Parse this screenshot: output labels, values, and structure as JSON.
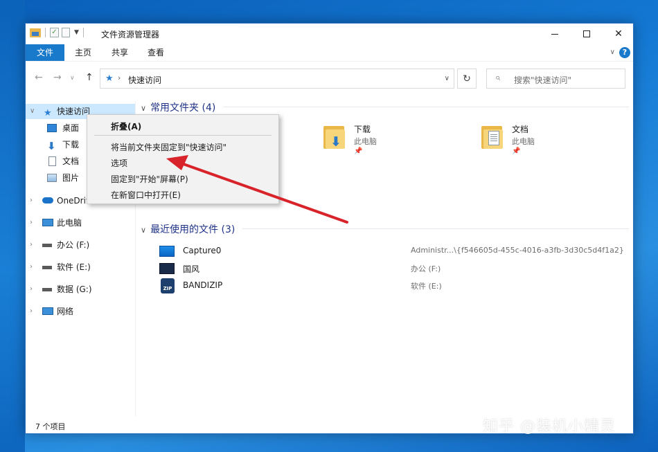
{
  "window": {
    "title": "文件资源管理器"
  },
  "ribbon": {
    "tabs": [
      "文件",
      "主页",
      "共享",
      "查看"
    ],
    "help_label": "?"
  },
  "nav": {
    "address_text": "快速访问",
    "search_placeholder": "搜索\"快速访问\""
  },
  "sidebar": {
    "items": [
      {
        "label": "快速访问",
        "icon": "star-icon"
      },
      {
        "label": "桌面",
        "icon": "desktop-icon"
      },
      {
        "label": "下载",
        "icon": "download-icon"
      },
      {
        "label": "文档",
        "icon": "document-icon"
      },
      {
        "label": "图片",
        "icon": "picture-icon"
      },
      {
        "label": "OneDrive",
        "icon": "cloud-icon"
      },
      {
        "label": "此电脑",
        "icon": "computer-icon"
      },
      {
        "label": "办公 (F:)",
        "icon": "drive-icon"
      },
      {
        "label": "软件 (E:)",
        "icon": "drive-icon"
      },
      {
        "label": "数据 (G:)",
        "icon": "drive-icon"
      },
      {
        "label": "网络",
        "icon": "network-icon"
      }
    ]
  },
  "content": {
    "frequent_header": "常用文件夹 (4)",
    "frequent_folders": [
      {
        "name": "下载",
        "sub": "此电脑",
        "icon": "download-folder-icon"
      },
      {
        "name": "文档",
        "sub": "此电脑",
        "icon": "document-folder-icon"
      }
    ],
    "recent_header": "最近使用的文件 (3)",
    "recent_files": [
      {
        "name": "Capture0",
        "path": "Administr...\\{f546605d-455c-4016-a3fb-3d30c5d4f1a2}",
        "icon": "image-file-icon"
      },
      {
        "name": "国风",
        "path": "办公 (F:)",
        "icon": "video-file-icon"
      },
      {
        "name": "BANDIZIP",
        "path": "软件 (E:)",
        "icon": "zip-file-icon"
      }
    ]
  },
  "status": {
    "item_count": "7 个项目"
  },
  "context_menu": {
    "items": [
      "折叠(A)",
      "将当前文件夹固定到\"快速访问\"",
      "选项",
      "固定到\"开始\"屏幕(P)",
      "在新窗口中打开(E)"
    ]
  },
  "watermark": "知乎 @装机小精灵",
  "colors": {
    "accent": "#1979ca",
    "annotation_arrow": "#d8232a",
    "selection": "#cce8ff"
  }
}
